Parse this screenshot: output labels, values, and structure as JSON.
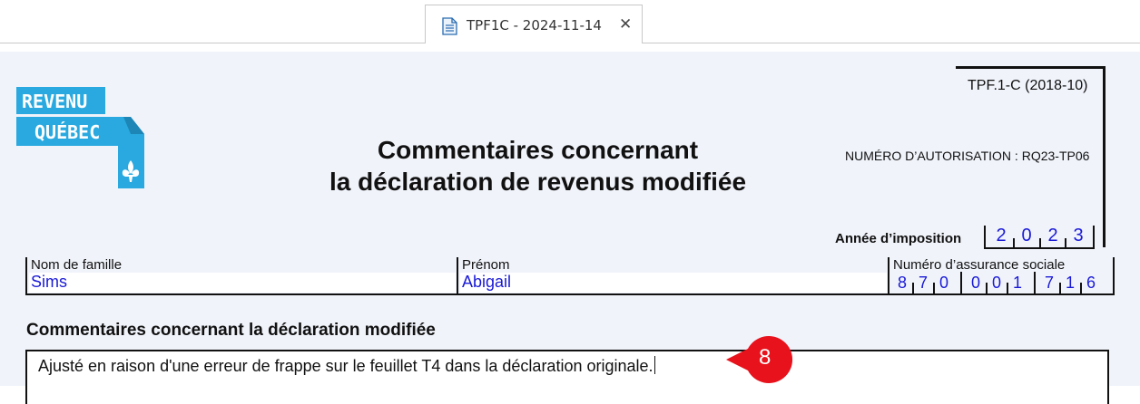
{
  "tab": {
    "title": "TPF1C - 2024-11-14",
    "close_label": "✕",
    "icon": "document-icon"
  },
  "logo": {
    "line1": "REVENU",
    "line2": "QUÉBEC",
    "brand_color": "#29a9df"
  },
  "form": {
    "code": "TPF.1-C (2018-10)",
    "authorization": "NUMÉRO D’AUTORISATION : RQ23-TP06",
    "title_line1": "Commentaires concernant",
    "title_line2": "la déclaration de revenus modifiée"
  },
  "tax_year": {
    "label": "Année d’imposition",
    "digits": [
      "2",
      "0",
      "2",
      "3"
    ]
  },
  "fields": {
    "last_name_label": "Nom de famille",
    "last_name": "Sims",
    "first_name_label": "Prénom",
    "first_name": "Abigail",
    "sin_label": "Numéro d’assurance sociale",
    "sin_digits": [
      "8",
      "7",
      "0",
      "0",
      "0",
      "1",
      "7",
      "1",
      "6"
    ]
  },
  "comments": {
    "section_title": "Commentaires concernant la déclaration modifiée",
    "text": "Ajusté en raison d'une erreur de frappe sur le feuillet T4 dans la déclaration originale."
  },
  "callout": {
    "number": "8",
    "color": "#e8121c"
  },
  "colors": {
    "value_blue": "#1a1ad6",
    "page_bg": "#f0f3fa"
  }
}
